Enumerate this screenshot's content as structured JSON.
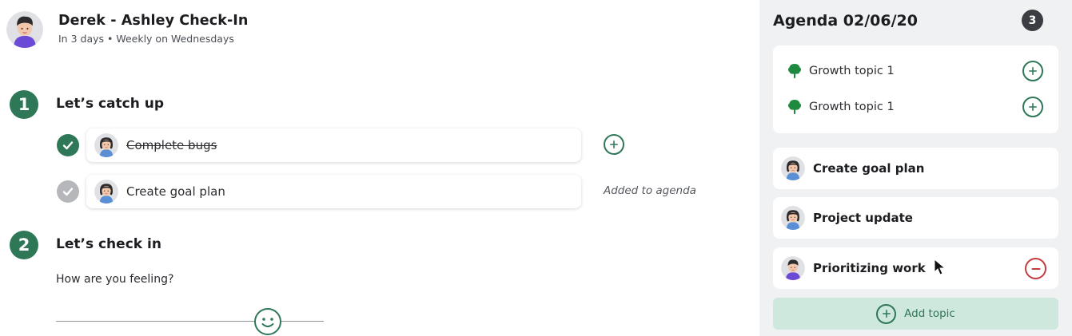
{
  "meeting": {
    "title": "Derek - Ashley Check-In",
    "subtitle": "In 3 days • Weekly on Wednesdays"
  },
  "sections": [
    {
      "number": "1",
      "title": "Let’s catch up",
      "items": [
        {
          "label": "Complete bugs",
          "completed": true,
          "action": "add-icon"
        },
        {
          "label": "Create goal plan",
          "completed": false,
          "status": "Added to agenda"
        }
      ]
    },
    {
      "number": "2",
      "title": "Let’s check in",
      "question": "How are you feeling?",
      "mood_level": 0.79,
      "mood_icon": "smiley-face-icon"
    }
  ],
  "agenda": {
    "title": "Agenda 02/06/20",
    "count": "3",
    "growth_topics": [
      {
        "label": "Growth topic 1",
        "icon": "tree-icon"
      },
      {
        "label": "Growth topic 1",
        "icon": "tree-icon"
      }
    ],
    "topics": [
      {
        "label": "Create goal plan"
      },
      {
        "label": "Project update"
      },
      {
        "label": "Prioritizing work",
        "action": "remove-icon"
      }
    ],
    "add_topic_label": "Add topic"
  },
  "colors": {
    "accent_green": "#2e7757",
    "light_green": "#cfe8dd",
    "remove_red": "#c23b3f",
    "panel_bg": "#f0f1f3"
  }
}
